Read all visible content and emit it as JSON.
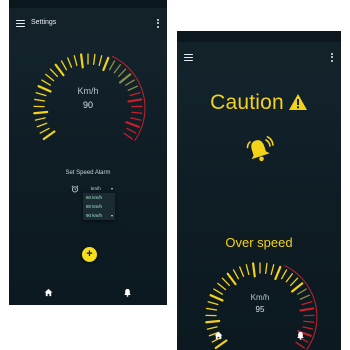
{
  "screen_a": {
    "header": {
      "title": "Settings",
      "menu_icon": "hamburger-menu-icon",
      "overflow_icon": "more-vert-icon"
    },
    "speedometer": {
      "unit": "Km/h",
      "value": "90",
      "level": 0.6
    },
    "speed_alarm": {
      "title": "Set Speed Alarm",
      "icon": "alarm-clock-icon",
      "selected": "km/h",
      "options": [
        "60 km/h",
        "80 km/h",
        "90 km/h"
      ]
    },
    "fab": {
      "label": "+",
      "icon": "add-icon"
    },
    "bottom_nav": [
      "home-icon",
      "notification-bell-icon"
    ]
  },
  "screen_b": {
    "header": {
      "menu_icon": "hamburger-menu-icon",
      "overflow_icon": "more-vert-icon"
    },
    "caution": {
      "text": "Caution",
      "icon": "warning-triangle-icon"
    },
    "alert_icon": "bell-ringing-icon",
    "overspeed": {
      "text": "Over speed"
    },
    "speedometer": {
      "unit": "Km/h",
      "value": "95",
      "level": 0.7
    },
    "bottom_nav": [
      "home-icon",
      "notification-bell-icon"
    ]
  },
  "colors": {
    "accent": "#f3d21a",
    "gauge_red": "#c8202a",
    "dropdown_text": "#a6e8ce",
    "background": "#13232b"
  }
}
